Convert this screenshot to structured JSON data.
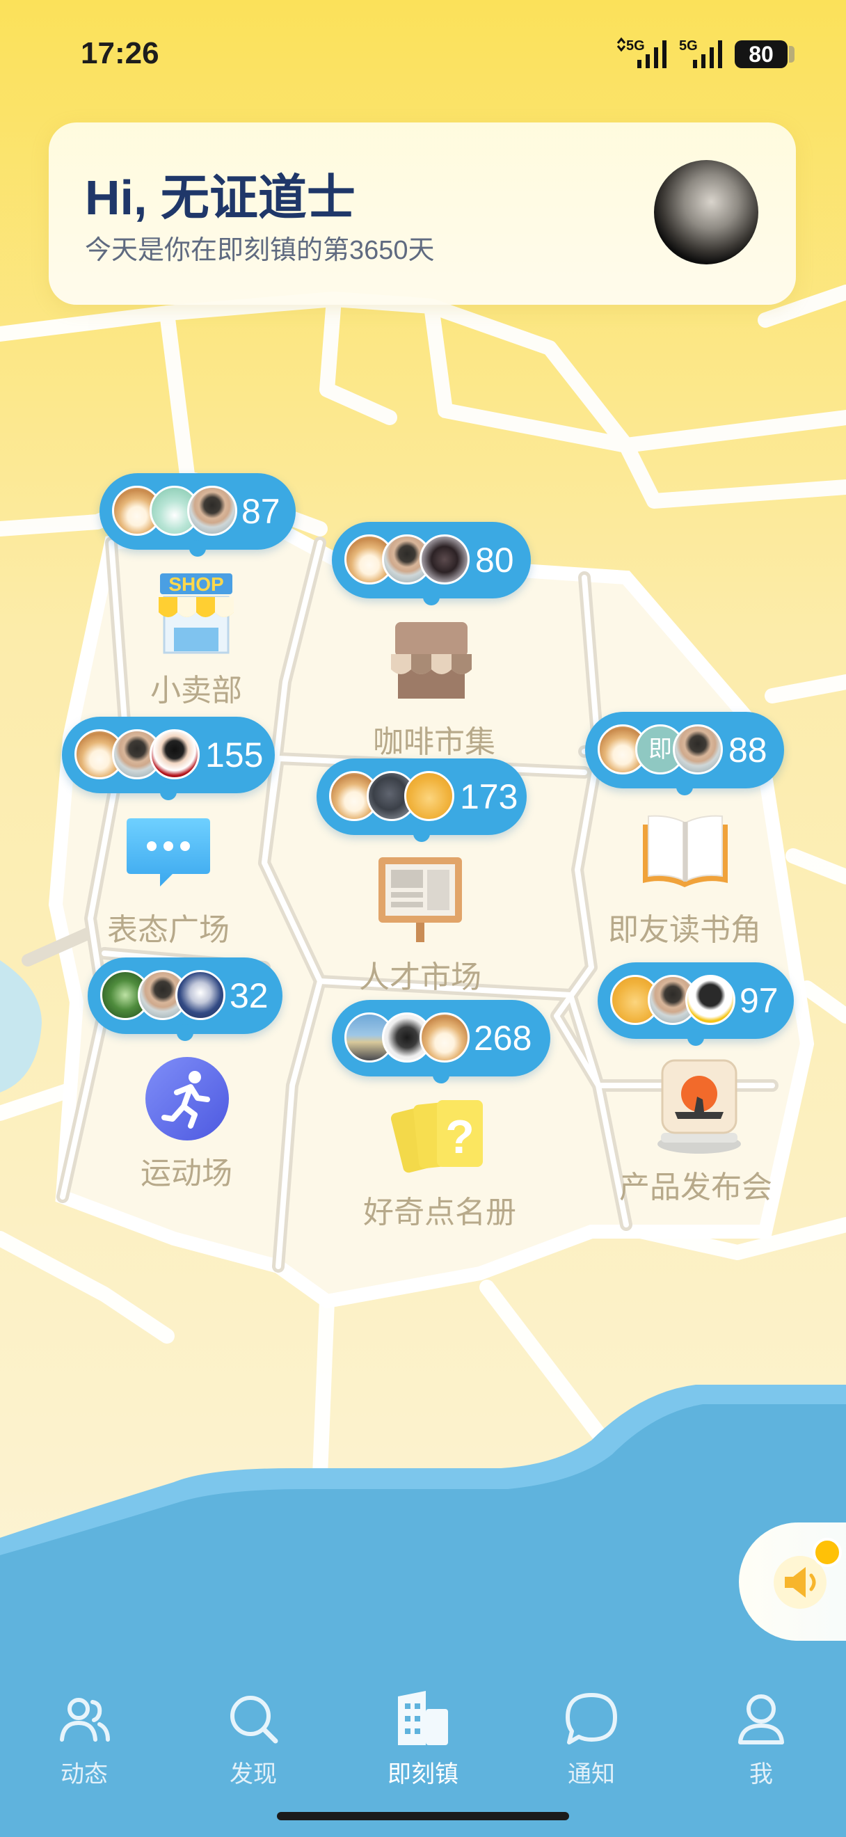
{
  "status_bar": {
    "time": "17:26",
    "network_1": "5G",
    "network_2": "5G",
    "battery": "80"
  },
  "header": {
    "greeting": "Hi, 无证道士",
    "subtitle": "今天是你在即刻镇的第3650天"
  },
  "buildings": [
    {
      "name": "小卖部",
      "count": "87",
      "icon": "shop-icon"
    },
    {
      "name": "咖啡市集",
      "count": "80",
      "icon": "coffee-stall-icon"
    },
    {
      "name": "表态广场",
      "count": "155",
      "icon": "chat-bubble-icon"
    },
    {
      "name": "人才市场",
      "count": "173",
      "icon": "bulletin-board-icon"
    },
    {
      "name": "即友读书角",
      "count": "88",
      "icon": "open-book-icon"
    },
    {
      "name": "运动场",
      "count": "32",
      "icon": "running-icon"
    },
    {
      "name": "好奇点名册",
      "count": "268",
      "icon": "question-cards-icon"
    },
    {
      "name": "产品发布会",
      "count": "97",
      "icon": "launch-app-icon"
    }
  ],
  "avatar_letter": "即",
  "tabs": [
    {
      "label": "动态",
      "icon": "people-icon"
    },
    {
      "label": "发现",
      "icon": "search-icon"
    },
    {
      "label": "即刻镇",
      "icon": "town-icon"
    },
    {
      "label": "通知",
      "icon": "message-icon"
    },
    {
      "label": "我",
      "icon": "profile-icon"
    }
  ],
  "colors": {
    "bubble": "#3ba9e3",
    "header_text": "#1f3769",
    "sea": "#5fb3dd",
    "label": "#b7a98a"
  }
}
